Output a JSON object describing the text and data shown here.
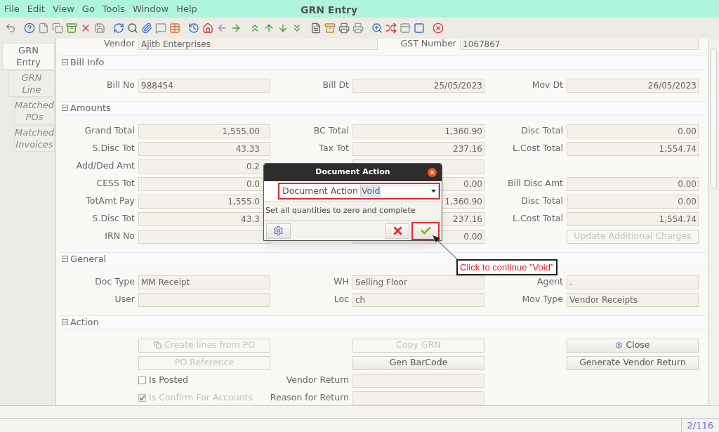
{
  "window": {
    "title": "GRN Entry"
  },
  "menu": [
    {
      "label": "File"
    },
    {
      "label": "Edit"
    },
    {
      "label": "View"
    },
    {
      "label": "Go"
    },
    {
      "label": "Tools"
    },
    {
      "label": "Window"
    },
    {
      "label": "Help"
    }
  ],
  "side_tabs": [
    {
      "label": "GRN Entry",
      "selected": true
    },
    {
      "label": "GRN Line",
      "selected": false
    },
    {
      "label": "Matched POs",
      "selected": false
    },
    {
      "label": "Matched Invoices",
      "selected": false
    }
  ],
  "header_row": [
    {
      "label": "Vendor",
      "value": "Ajith Enterprises"
    },
    {
      "label": "GST Number",
      "value": "1067867"
    }
  ],
  "sections": [
    {
      "title": "Bill Info",
      "expanded": true,
      "rows": [
        [
          {
            "kind": "field",
            "label": "Bill No",
            "value": "988454"
          },
          {
            "kind": "field",
            "label": "Bill Dt",
            "value": "25/05/2023",
            "numeric": true
          },
          {
            "kind": "field",
            "label": "Mov Dt",
            "value": "26/05/2023",
            "numeric": true
          }
        ]
      ]
    },
    {
      "title": "Amounts",
      "expanded": true,
      "rows": [
        [
          {
            "kind": "field",
            "label": "Grand Total",
            "value": "1,555.00",
            "numeric": true
          },
          {
            "kind": "field",
            "label": "BC Total",
            "value": "1,360.90",
            "numeric": true
          },
          {
            "kind": "field",
            "label": "Disc Total",
            "value": "0.00",
            "numeric": true
          }
        ],
        [
          {
            "kind": "field",
            "label": "S.Disc Tot",
            "value": "43.33",
            "numeric": true
          },
          {
            "kind": "field",
            "label": "Tax Tot",
            "value": "237.16",
            "numeric": true
          },
          {
            "kind": "field",
            "label": "L.Cost Total",
            "value": "1,554.74",
            "numeric": true
          }
        ],
        [
          {
            "kind": "field",
            "label": "Add/Ded Amt",
            "value": "0.2",
            "numeric": true
          },
          {
            "kind": "field",
            "numeric": true
          },
          {
            "kind": "empty"
          }
        ],
        [
          {
            "kind": "field",
            "label": "CESS Tot",
            "value": "0.0",
            "numeric": true
          },
          {
            "kind": "field",
            "value": "0.00",
            "numeric": true
          },
          {
            "kind": "field",
            "label": "Bill Disc Amt",
            "value": "0.00",
            "numeric": true
          }
        ],
        [
          {
            "kind": "field",
            "label": "TotAmt Pay",
            "value": "1,555.0",
            "numeric": true
          },
          {
            "kind": "field",
            "value": "1,360.90",
            "numeric": true
          },
          {
            "kind": "field",
            "label": "Disc Total",
            "value": "0.00",
            "numeric": true
          }
        ],
        [
          {
            "kind": "field",
            "label": "S.Disc Tot",
            "value": "43.3",
            "numeric": true
          },
          {
            "kind": "field",
            "value": "237.16",
            "numeric": true
          },
          {
            "kind": "field",
            "label": "L.Cost Total",
            "value": "1,554.74",
            "numeric": true
          }
        ],
        [
          {
            "kind": "field",
            "label": "IRN No"
          },
          {
            "kind": "field",
            "value": "0.00",
            "numeric": true
          },
          {
            "kind": "button",
            "label": "Update Additional Charges",
            "disabled": true
          }
        ]
      ]
    },
    {
      "title": "General",
      "expanded": true,
      "rows": [
        [
          {
            "kind": "field",
            "label": "Doc Type",
            "value": "MM Receipt"
          },
          {
            "kind": "field",
            "label": "WH",
            "value": "Selling Floor"
          },
          {
            "kind": "field",
            "label": "Agent",
            "value": "."
          }
        ],
        [
          {
            "kind": "field",
            "label": "User"
          },
          {
            "kind": "field",
            "label": "Loc",
            "value": "ch"
          },
          {
            "kind": "field",
            "label": "Mov Type",
            "value": "Vendor Receipts"
          }
        ]
      ]
    },
    {
      "title": "Action",
      "expanded": true,
      "rows": [
        [
          {
            "kind": "button",
            "label": "Create lines from PO",
            "disabled": true
          },
          {
            "kind": "button",
            "label": "Copy GRN",
            "disabled": true
          },
          {
            "kind": "button",
            "label": "Close",
            "disabled": false
          }
        ],
        [
          {
            "kind": "button",
            "label": "PO Reference",
            "disabled": true
          },
          {
            "kind": "button",
            "label": "Gen BarCode",
            "disabled": false
          },
          {
            "kind": "button",
            "label": "Generate Vendor Return",
            "disabled": false
          }
        ],
        [
          {
            "kind": "checkbox",
            "label": "Is Posted",
            "checked": false,
            "disabled": false
          },
          {
            "kind": "field",
            "label": "Vendor Return"
          },
          {
            "kind": "empty"
          }
        ],
        [
          {
            "kind": "checkbox",
            "label": "Is Confirm For Accounts",
            "checked": true,
            "disabled": true
          },
          {
            "kind": "field",
            "label": "Reason for Return"
          },
          {
            "kind": "empty"
          }
        ]
      ]
    }
  ],
  "dialog": {
    "title": "Document Action",
    "field_label": "Document Action",
    "value": "Void",
    "description": "Set all quantities to zero and complete"
  },
  "callout": {
    "text": "Click to continue \"Void\""
  },
  "status_bar": {
    "record": "2/116"
  }
}
